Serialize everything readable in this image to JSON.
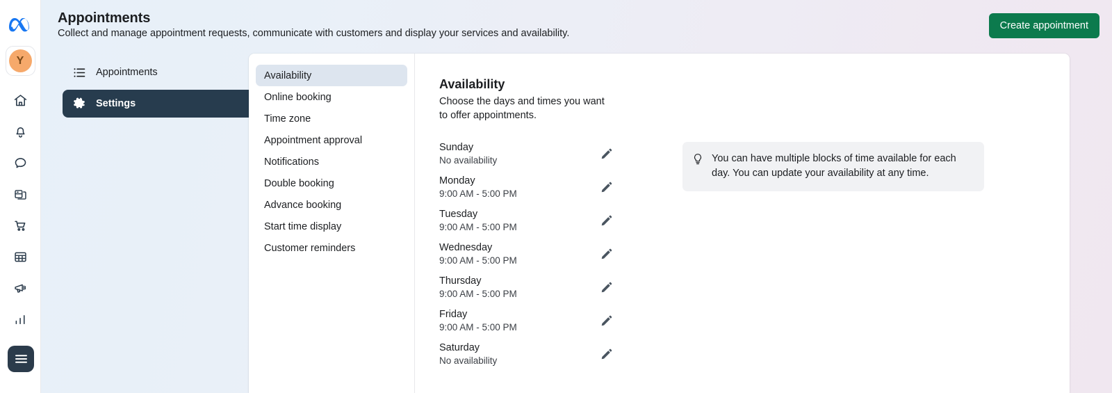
{
  "brand": {
    "logo_icon": "meta-logo-icon",
    "avatar_initial": "Y"
  },
  "rail": {
    "items": [
      {
        "icon": "home-icon",
        "name": "home"
      },
      {
        "icon": "bell-icon",
        "name": "notifications"
      },
      {
        "icon": "chat-bubble-icon",
        "name": "messages"
      },
      {
        "icon": "pages-icon",
        "name": "pages"
      },
      {
        "icon": "shopping-cart-icon",
        "name": "commerce"
      },
      {
        "icon": "grid-table-icon",
        "name": "table"
      },
      {
        "icon": "megaphone-icon",
        "name": "ads"
      },
      {
        "icon": "bar-chart-icon",
        "name": "insights"
      }
    ],
    "menu_icon": "hamburger-menu-icon"
  },
  "header": {
    "title": "Appointments",
    "subtitle": "Collect and manage appointment requests, communicate with customers and display your services and availability.",
    "create_button": "Create appointment",
    "create_button_color": "#0c7a4d"
  },
  "left_nav": {
    "items": [
      {
        "label": "Appointments",
        "icon": "list-icon",
        "active": false
      },
      {
        "label": "Settings",
        "icon": "gear-icon",
        "active": true
      }
    ],
    "active_bg": "#273c4e"
  },
  "settings_menu": {
    "selected": "Availability",
    "selected_bg": "#dde5ef",
    "items": [
      "Availability",
      "Online booking",
      "Time zone",
      "Appointment approval",
      "Notifications",
      "Double booking",
      "Advance booking",
      "Start time display",
      "Customer reminders"
    ]
  },
  "availability": {
    "title": "Availability",
    "description": "Choose the days and times you want to offer appointments.",
    "edit_icon": "pencil-icon",
    "days": [
      {
        "name": "Sunday",
        "time": "No availability"
      },
      {
        "name": "Monday",
        "time": "9:00 AM - 5:00 PM"
      },
      {
        "name": "Tuesday",
        "time": "9:00 AM - 5:00 PM"
      },
      {
        "name": "Wednesday",
        "time": "9:00 AM - 5:00 PM"
      },
      {
        "name": "Thursday",
        "time": "9:00 AM - 5:00 PM"
      },
      {
        "name": "Friday",
        "time": "9:00 AM - 5:00 PM"
      },
      {
        "name": "Saturday",
        "time": "No availability"
      }
    ]
  },
  "tip": {
    "icon": "lightbulb-icon",
    "text": "You can have multiple blocks of time available for each day. You can update your availability at any time.",
    "bg": "#f1f2f4"
  }
}
